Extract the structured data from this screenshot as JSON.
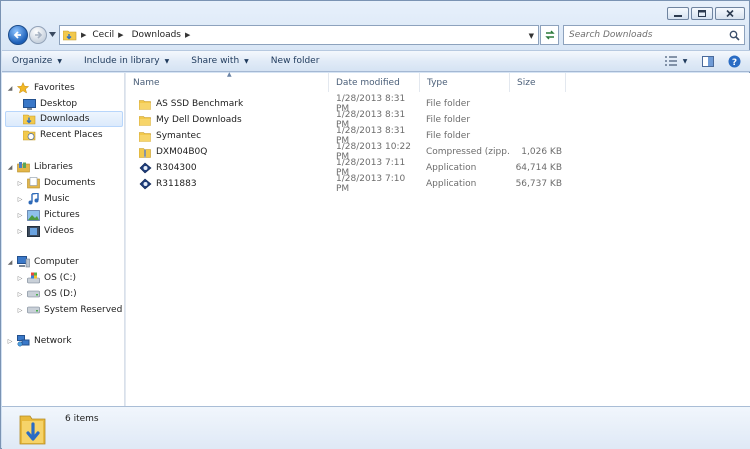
{
  "address": {
    "crumbs": [
      "Cecil",
      "Downloads"
    ]
  },
  "search": {
    "placeholder": "Search Downloads"
  },
  "toolbar": {
    "organize": "Organize",
    "include_in_library": "Include in library",
    "share_with": "Share with",
    "new_folder": "New folder"
  },
  "nav": {
    "favorites": {
      "label": "Favorites",
      "items": [
        "Desktop",
        "Downloads",
        "Recent Places"
      ]
    },
    "libraries": {
      "label": "Libraries",
      "items": [
        "Documents",
        "Music",
        "Pictures",
        "Videos"
      ]
    },
    "computer": {
      "label": "Computer",
      "items": [
        "OS (C:)",
        "OS (D:)",
        "System Reserved (F:)"
      ]
    },
    "network": {
      "label": "Network"
    }
  },
  "columns": {
    "name": "Name",
    "date": "Date modified",
    "type": "Type",
    "size": "Size"
  },
  "files": [
    {
      "name": "AS SSD Benchmark",
      "date": "1/28/2013 8:31 PM",
      "type": "File folder",
      "size": "",
      "icon": "folder-icon"
    },
    {
      "name": "My Dell Downloads",
      "date": "1/28/2013 8:31 PM",
      "type": "File folder",
      "size": "",
      "icon": "folder-icon"
    },
    {
      "name": "Symantec",
      "date": "1/28/2013 8:31 PM",
      "type": "File folder",
      "size": "",
      "icon": "folder-icon"
    },
    {
      "name": "DXM04B0Q",
      "date": "1/28/2013 10:22 PM",
      "type": "Compressed (zipp...",
      "size": "1,026 KB",
      "icon": "zip-folder-icon"
    },
    {
      "name": "R304300",
      "date": "1/28/2013 7:11 PM",
      "type": "Application",
      "size": "64,714 KB",
      "icon": "application-icon"
    },
    {
      "name": "R311883",
      "date": "1/28/2013 7:10 PM",
      "type": "Application",
      "size": "56,737 KB",
      "icon": "application-icon"
    }
  ],
  "details": {
    "count": "6 items"
  },
  "colors": {
    "selection": "#dbeafc",
    "accent": "#1c5fb8",
    "folder": "#f2c94c"
  }
}
